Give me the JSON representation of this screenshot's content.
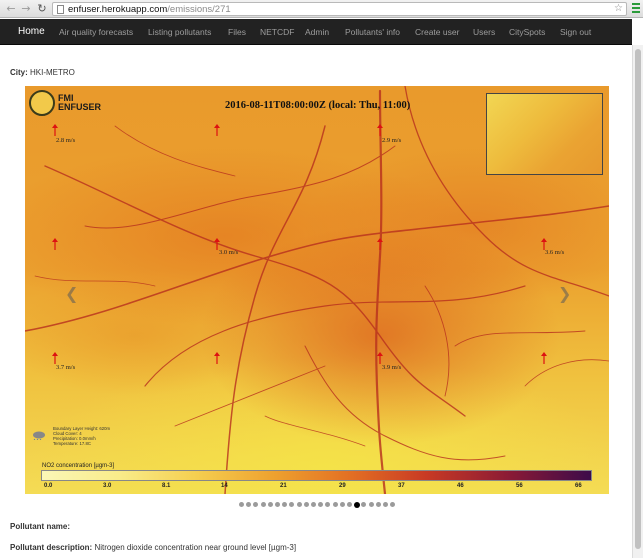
{
  "browser": {
    "url_host": "enfuser.herokuapp.com",
    "url_path": "/emissions/271"
  },
  "navbar": {
    "items": [
      {
        "label": "Home"
      },
      {
        "label": "Air quality forecasts"
      },
      {
        "label": "Listing pollutants"
      },
      {
        "label": "Files"
      },
      {
        "label": "NETCDF"
      },
      {
        "label": "Admin"
      },
      {
        "label": "Pollutants' info"
      },
      {
        "label": "Create user"
      },
      {
        "label": "Users"
      },
      {
        "label": "CitySpots"
      },
      {
        "label": "Sign out"
      }
    ]
  },
  "city": {
    "label": "City:",
    "value": "HKI-METRO"
  },
  "map": {
    "logo_line1": "FMI",
    "logo_line2": "ENFUSER",
    "timestamp": "2016-08-11T08:00:00Z (local: Thu, 11:00)",
    "wind_labels": [
      "2.8 m/s",
      "2.9 m/s",
      "3.0 m/s",
      "3.6 m/s",
      "3.7 m/s",
      "3.9 m/s"
    ],
    "weather_lines": [
      "Boundary Layer Height: 620m",
      "Cloud Cover: 4",
      "Precipitation: 0.0mm/h",
      "Temperature: 17.8C"
    ],
    "colorbar": {
      "title": "NO2 concentration [µgm-3]",
      "ticks": [
        "0.0",
        "3.0",
        "8.1",
        "14",
        "21",
        "29",
        "37",
        "46",
        "56",
        "66"
      ]
    }
  },
  "carousel": {
    "count": 22,
    "active_index": 16
  },
  "pollutant": {
    "name_label": "Pollutant name:",
    "name_value": "",
    "description_label": "Pollutant description:",
    "description_value": "Nitrogen dioxide concentration near ground level [µgm-3]"
  },
  "colors": {
    "navbar_bg": "#222222",
    "navbar_text": "#9d9d9d",
    "road": "#b8301e"
  }
}
